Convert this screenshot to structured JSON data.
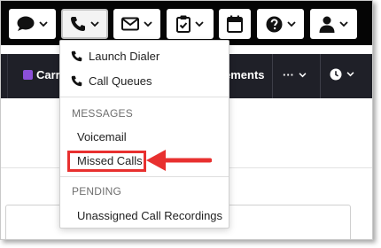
{
  "topbar": {
    "icons": [
      {
        "name": "chat-icon"
      },
      {
        "name": "phone-icon"
      },
      {
        "name": "mail-icon"
      },
      {
        "name": "clipboard-check-icon"
      },
      {
        "name": "calendar-icon"
      },
      {
        "name": "help-icon"
      },
      {
        "name": "user-icon"
      }
    ]
  },
  "navbar": {
    "carrier_label": "Carri",
    "partial_label": "ements",
    "more_label": "···"
  },
  "dropdown": {
    "items": [
      {
        "label": "Launch Dialer",
        "icon": "phone-icon"
      },
      {
        "label": "Call Queues",
        "icon": "phone-icon"
      }
    ],
    "messages_header": "MESSAGES",
    "voicemail_label": "Voicemail",
    "missed_calls_label": "Missed Calls",
    "pending_header": "PENDING",
    "recordings_label": "Unassigned Call Recordings"
  },
  "colors": {
    "topbar": "#050505",
    "navbar": "#1f2028",
    "carrier_swatch": "#8b4fd8",
    "annotation": "#e8302f"
  }
}
